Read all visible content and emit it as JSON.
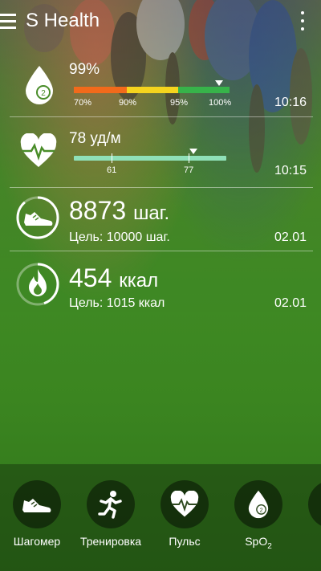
{
  "appbar": {
    "title": "S Health",
    "menu_icon": "menu-icon",
    "overflow_icon": "more-vert-icon"
  },
  "spo2": {
    "icon": "spo2-drop-icon",
    "value": "99%",
    "scale": [
      "70%",
      "90%",
      "95%",
      "100%"
    ],
    "level_percent": 99,
    "time": "10:16",
    "colors": {
      "low": "#f26a1b",
      "mid": "#f5d41e",
      "high": "#37b34a"
    }
  },
  "heart_rate": {
    "icon": "heart-rate-icon",
    "value": "78 уд/м",
    "range_low": "61",
    "range_high": "77",
    "current": 78,
    "time": "10:15",
    "bar_color": "#8fe0b8"
  },
  "steps": {
    "icon": "shoe-icon",
    "value": "8873",
    "unit": "шаг.",
    "goal": "Цель: 10000 шаг.",
    "progress": 0.887,
    "date": "02.01"
  },
  "calories": {
    "icon": "flame-icon",
    "value": "454",
    "unit": "ккал",
    "goal": "Цель: 1015 ккал",
    "progress": 0.447,
    "date": "02.01"
  },
  "shortcuts": [
    {
      "label": "Шагомер",
      "icon": "shoe-icon"
    },
    {
      "label": "Тренировка",
      "icon": "runner-icon"
    },
    {
      "label": "Пульс",
      "icon": "heart-rate-icon"
    },
    {
      "label": "SpO",
      "label_sub": "2",
      "icon": "spo2-drop-icon"
    }
  ]
}
